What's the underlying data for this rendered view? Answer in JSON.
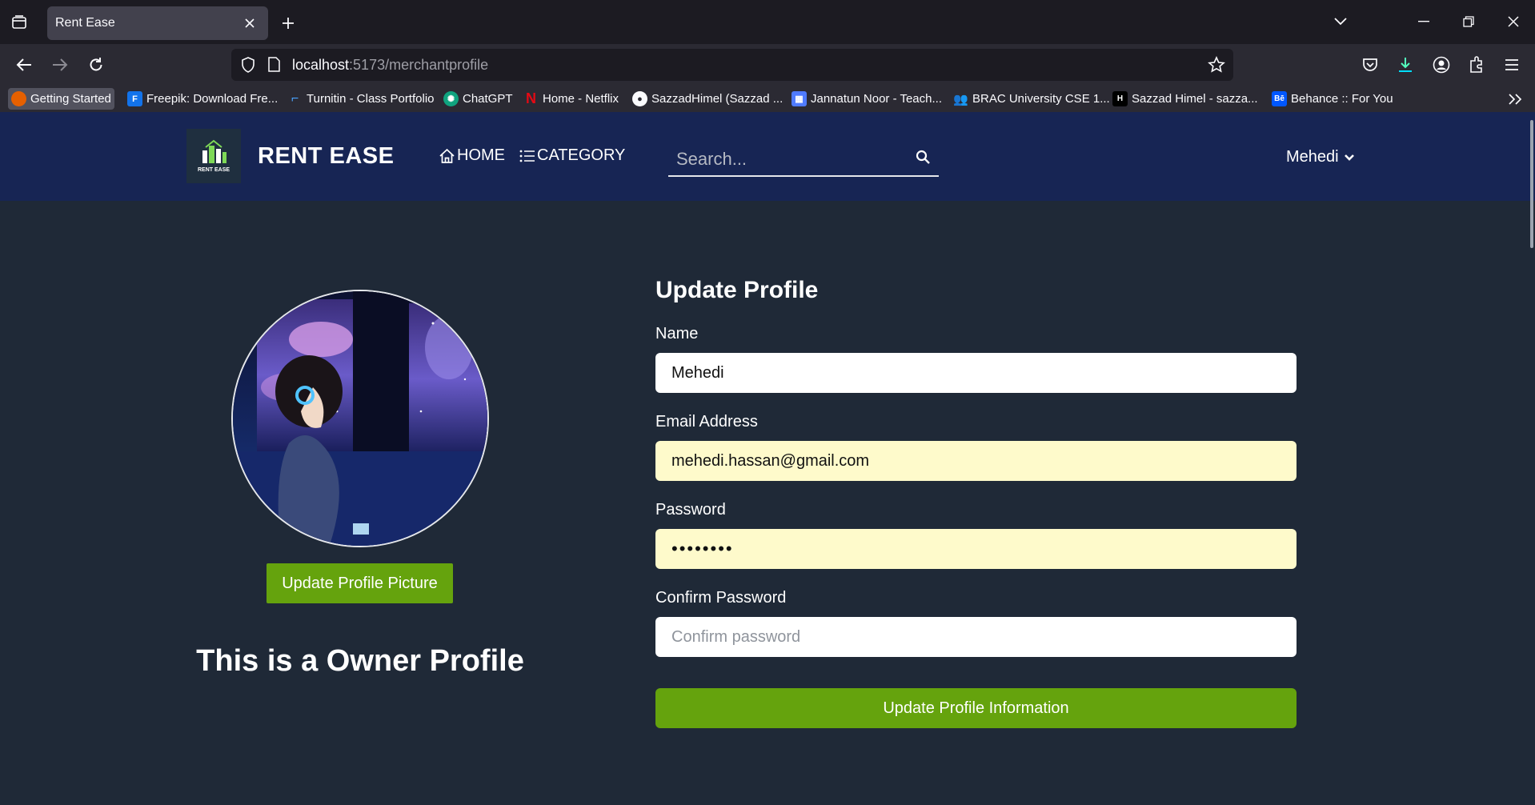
{
  "browser": {
    "tab_title": "Rent Ease",
    "url_host": "localhost",
    "url_path": ":5173/merchantprofile",
    "bookmarks": [
      {
        "label": "Getting Started",
        "icon": "firefox-icon",
        "color": "#e66000"
      },
      {
        "label": "Freepik: Download Fre...",
        "icon": "freepik-icon",
        "color": "#1273eb"
      },
      {
        "label": "Turnitin - Class Portfolio",
        "icon": "turnitin-icon",
        "color": "#1e88e5"
      },
      {
        "label": "ChatGPT",
        "icon": "chatgpt-icon",
        "color": "#10a37f"
      },
      {
        "label": "Home - Netflix",
        "icon": "netflix-icon",
        "color": "#e50914"
      },
      {
        "label": "SazzadHimel (Sazzad ...",
        "icon": "github-icon",
        "color": "#ffffff"
      },
      {
        "label": "Jannatun Noor - Teach...",
        "icon": "calendar-icon",
        "color": "#4f7bff"
      },
      {
        "label": "BRAC University CSE 1...",
        "icon": "people-icon",
        "color": "#5b8def"
      },
      {
        "label": "Sazzad Himel - sazza...",
        "icon": "hashnode-icon",
        "color": "#000000"
      },
      {
        "label": "Behance :: For You",
        "icon": "behance-icon",
        "color": "#0057ff"
      }
    ]
  },
  "header": {
    "brand": "RENT EASE",
    "logo_text": "RENT EASE",
    "home": "HOME",
    "category": "CATEGORY",
    "search_placeholder": "Search...",
    "user": "Mehedi"
  },
  "profile": {
    "update_picture": "Update Profile Picture",
    "owner_title": "This is a Owner Profile"
  },
  "form": {
    "title": "Update Profile",
    "name_label": "Name",
    "name_value": "Mehedi",
    "email_label": "Email Address",
    "email_value": "mehedi.hassan@gmail.com",
    "password_label": "Password",
    "password_value": "••••••••",
    "confirm_label": "Confirm Password",
    "confirm_placeholder": "Confirm password",
    "submit": "Update Profile Information"
  },
  "colors": {
    "header_bg": "#172554",
    "page_bg": "#1f2937",
    "accent_green": "#65a30d",
    "autofill": "#fefacb"
  }
}
